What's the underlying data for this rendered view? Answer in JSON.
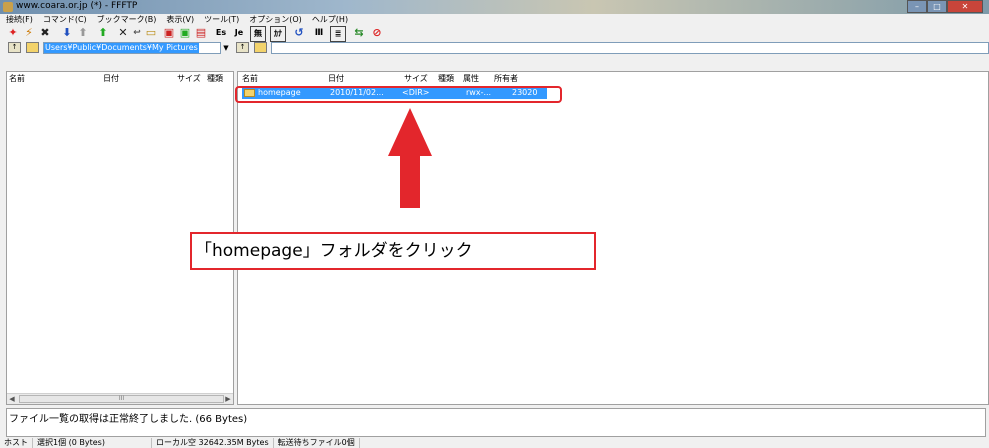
{
  "window": {
    "title": "www.coara.or.jp (*) - FFFTP"
  },
  "menu": [
    "接続(F)",
    "コマンド(C)",
    "ブックマーク(B)",
    "表示(V)",
    "ツール(T)",
    "オプション(O)",
    "ヘルプ(H)"
  ],
  "toolbar": {
    "icons": [
      "connect-icon",
      "disconnect-icon",
      "quick-connect-icon",
      "download-icon",
      "upload-icon",
      "mirror-upload-icon",
      "delete-icon",
      "rename-icon",
      "mkdir-icon",
      "open-icon",
      "copy-icon",
      "paste-icon",
      "sjis-icon",
      "jis-icon",
      "no-convert-icon",
      "kana-convert-icon",
      "refresh-icon",
      "list-view-icon",
      "detail-view-icon",
      "sync-icon",
      "stop-icon"
    ]
  },
  "local": {
    "path": "Users¥Public¥Documents¥My Pictures",
    "columns": [
      "名前",
      "日付",
      "サイズ",
      "種類"
    ],
    "scroll_mark": "III"
  },
  "remote": {
    "columns": [
      "名前",
      "日付",
      "サイズ",
      "種類",
      "属性",
      "所有者"
    ],
    "rows": [
      {
        "name": "homepage",
        "date": "2010/11/02...",
        "size": "<DIR>",
        "attr": "rwx-...",
        "owner": "23020"
      }
    ]
  },
  "annotation": {
    "callout": "「homepage」フォルダをクリック",
    "arrow_color": "#e3262c"
  },
  "log": {
    "message": "ファイル一覧の取得は正常終了しました. (66 Bytes)"
  },
  "status": {
    "host": "ホスト",
    "selection": "選択1個 (0 Bytes)",
    "local_free": "ローカル空 32642.35M Bytes",
    "queue": "転送待ちファイル0個"
  }
}
